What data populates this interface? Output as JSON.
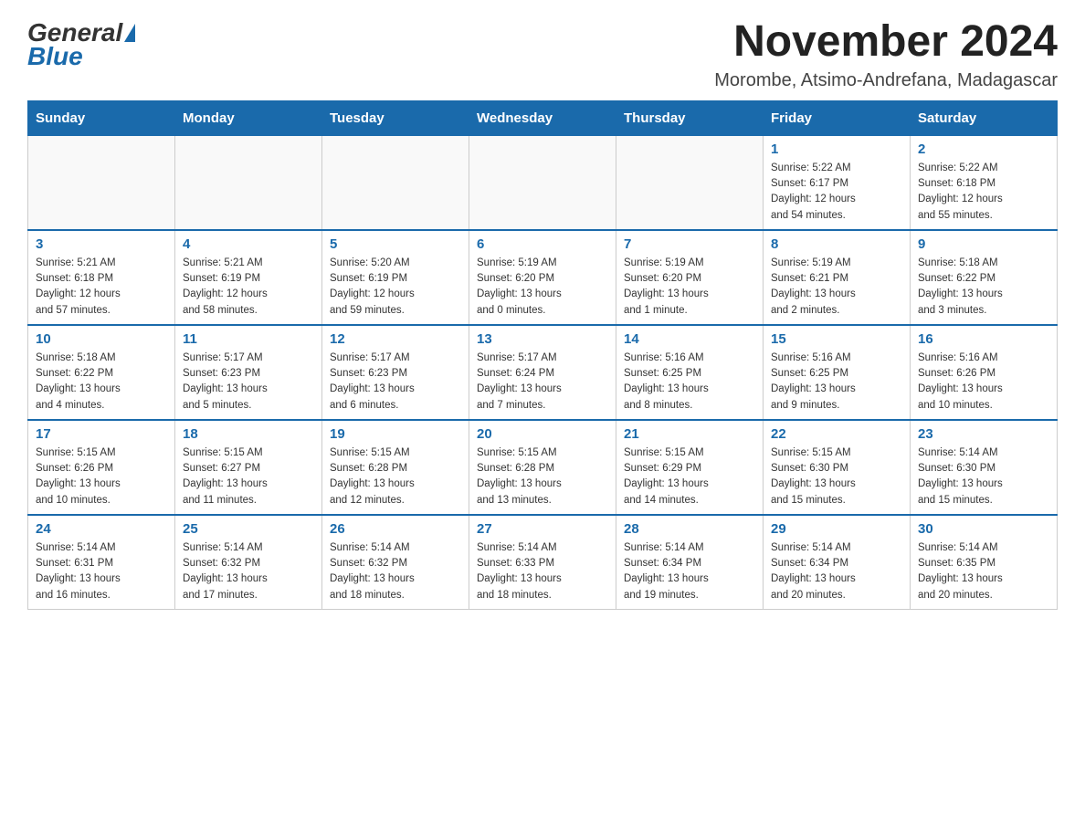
{
  "header": {
    "logo_general": "General",
    "logo_blue": "Blue",
    "month_title": "November 2024",
    "location": "Morombe, Atsimo-Andrefana, Madagascar"
  },
  "days_of_week": [
    "Sunday",
    "Monday",
    "Tuesday",
    "Wednesday",
    "Thursday",
    "Friday",
    "Saturday"
  ],
  "weeks": [
    {
      "days": [
        {
          "number": "",
          "info": ""
        },
        {
          "number": "",
          "info": ""
        },
        {
          "number": "",
          "info": ""
        },
        {
          "number": "",
          "info": ""
        },
        {
          "number": "",
          "info": ""
        },
        {
          "number": "1",
          "info": "Sunrise: 5:22 AM\nSunset: 6:17 PM\nDaylight: 12 hours\nand 54 minutes."
        },
        {
          "number": "2",
          "info": "Sunrise: 5:22 AM\nSunset: 6:18 PM\nDaylight: 12 hours\nand 55 minutes."
        }
      ]
    },
    {
      "days": [
        {
          "number": "3",
          "info": "Sunrise: 5:21 AM\nSunset: 6:18 PM\nDaylight: 12 hours\nand 57 minutes."
        },
        {
          "number": "4",
          "info": "Sunrise: 5:21 AM\nSunset: 6:19 PM\nDaylight: 12 hours\nand 58 minutes."
        },
        {
          "number": "5",
          "info": "Sunrise: 5:20 AM\nSunset: 6:19 PM\nDaylight: 12 hours\nand 59 minutes."
        },
        {
          "number": "6",
          "info": "Sunrise: 5:19 AM\nSunset: 6:20 PM\nDaylight: 13 hours\nand 0 minutes."
        },
        {
          "number": "7",
          "info": "Sunrise: 5:19 AM\nSunset: 6:20 PM\nDaylight: 13 hours\nand 1 minute."
        },
        {
          "number": "8",
          "info": "Sunrise: 5:19 AM\nSunset: 6:21 PM\nDaylight: 13 hours\nand 2 minutes."
        },
        {
          "number": "9",
          "info": "Sunrise: 5:18 AM\nSunset: 6:22 PM\nDaylight: 13 hours\nand 3 minutes."
        }
      ]
    },
    {
      "days": [
        {
          "number": "10",
          "info": "Sunrise: 5:18 AM\nSunset: 6:22 PM\nDaylight: 13 hours\nand 4 minutes."
        },
        {
          "number": "11",
          "info": "Sunrise: 5:17 AM\nSunset: 6:23 PM\nDaylight: 13 hours\nand 5 minutes."
        },
        {
          "number": "12",
          "info": "Sunrise: 5:17 AM\nSunset: 6:23 PM\nDaylight: 13 hours\nand 6 minutes."
        },
        {
          "number": "13",
          "info": "Sunrise: 5:17 AM\nSunset: 6:24 PM\nDaylight: 13 hours\nand 7 minutes."
        },
        {
          "number": "14",
          "info": "Sunrise: 5:16 AM\nSunset: 6:25 PM\nDaylight: 13 hours\nand 8 minutes."
        },
        {
          "number": "15",
          "info": "Sunrise: 5:16 AM\nSunset: 6:25 PM\nDaylight: 13 hours\nand 9 minutes."
        },
        {
          "number": "16",
          "info": "Sunrise: 5:16 AM\nSunset: 6:26 PM\nDaylight: 13 hours\nand 10 minutes."
        }
      ]
    },
    {
      "days": [
        {
          "number": "17",
          "info": "Sunrise: 5:15 AM\nSunset: 6:26 PM\nDaylight: 13 hours\nand 10 minutes."
        },
        {
          "number": "18",
          "info": "Sunrise: 5:15 AM\nSunset: 6:27 PM\nDaylight: 13 hours\nand 11 minutes."
        },
        {
          "number": "19",
          "info": "Sunrise: 5:15 AM\nSunset: 6:28 PM\nDaylight: 13 hours\nand 12 minutes."
        },
        {
          "number": "20",
          "info": "Sunrise: 5:15 AM\nSunset: 6:28 PM\nDaylight: 13 hours\nand 13 minutes."
        },
        {
          "number": "21",
          "info": "Sunrise: 5:15 AM\nSunset: 6:29 PM\nDaylight: 13 hours\nand 14 minutes."
        },
        {
          "number": "22",
          "info": "Sunrise: 5:15 AM\nSunset: 6:30 PM\nDaylight: 13 hours\nand 15 minutes."
        },
        {
          "number": "23",
          "info": "Sunrise: 5:14 AM\nSunset: 6:30 PM\nDaylight: 13 hours\nand 15 minutes."
        }
      ]
    },
    {
      "days": [
        {
          "number": "24",
          "info": "Sunrise: 5:14 AM\nSunset: 6:31 PM\nDaylight: 13 hours\nand 16 minutes."
        },
        {
          "number": "25",
          "info": "Sunrise: 5:14 AM\nSunset: 6:32 PM\nDaylight: 13 hours\nand 17 minutes."
        },
        {
          "number": "26",
          "info": "Sunrise: 5:14 AM\nSunset: 6:32 PM\nDaylight: 13 hours\nand 18 minutes."
        },
        {
          "number": "27",
          "info": "Sunrise: 5:14 AM\nSunset: 6:33 PM\nDaylight: 13 hours\nand 18 minutes."
        },
        {
          "number": "28",
          "info": "Sunrise: 5:14 AM\nSunset: 6:34 PM\nDaylight: 13 hours\nand 19 minutes."
        },
        {
          "number": "29",
          "info": "Sunrise: 5:14 AM\nSunset: 6:34 PM\nDaylight: 13 hours\nand 20 minutes."
        },
        {
          "number": "30",
          "info": "Sunrise: 5:14 AM\nSunset: 6:35 PM\nDaylight: 13 hours\nand 20 minutes."
        }
      ]
    }
  ]
}
